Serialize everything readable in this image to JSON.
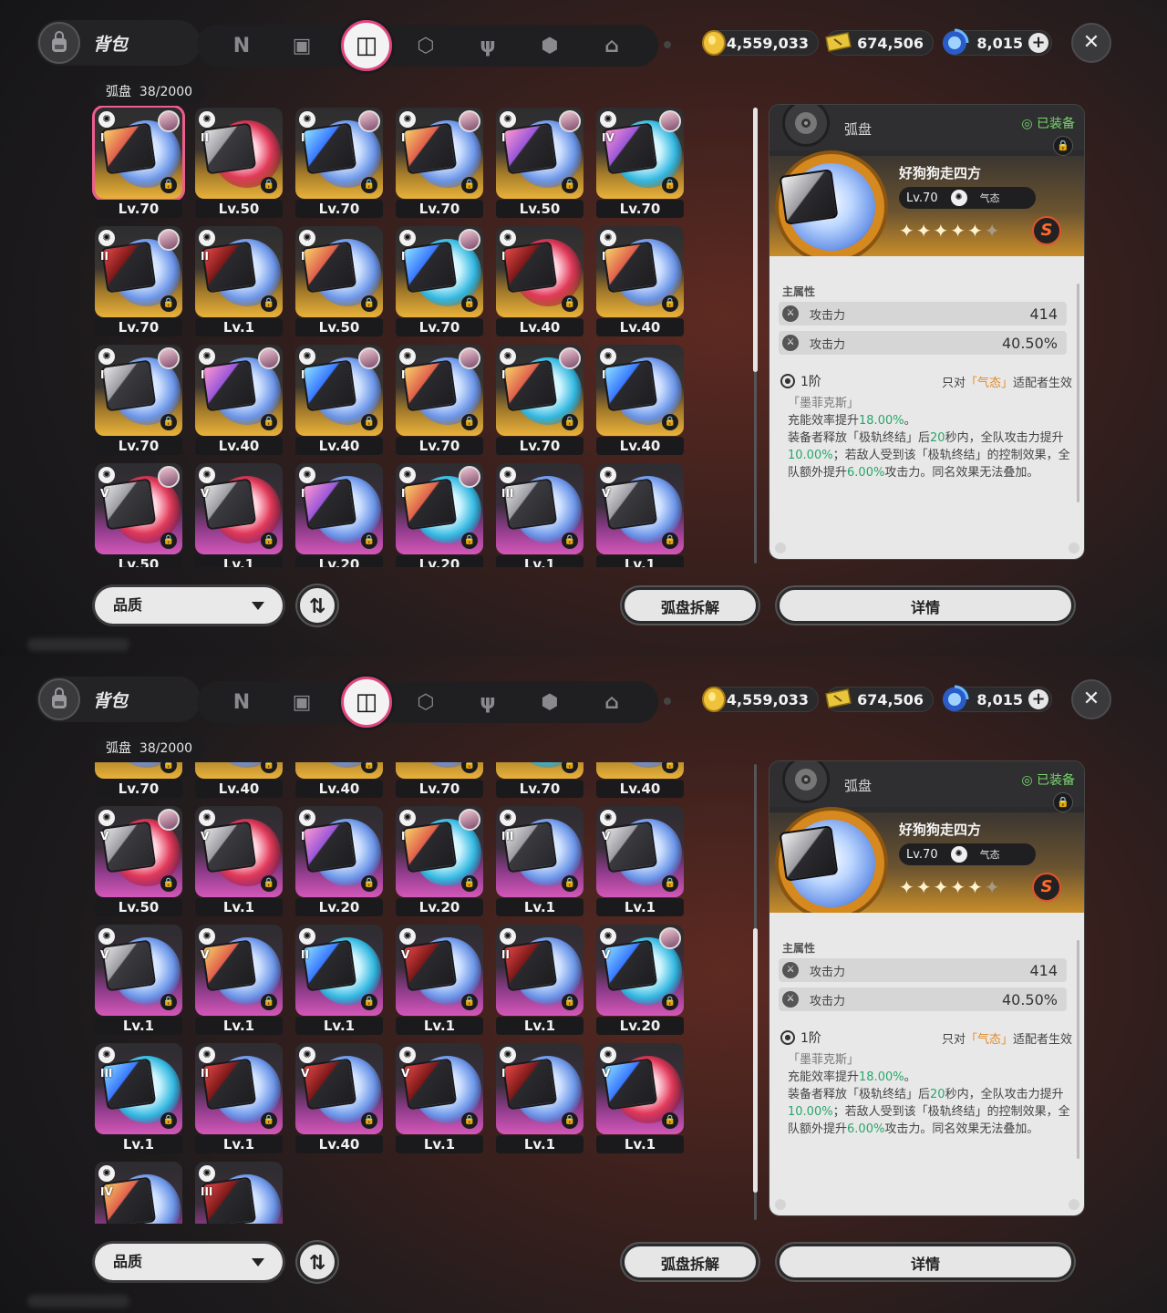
{
  "bag": {
    "title": "背包",
    "icon": "backpack-icon"
  },
  "tabs": [
    {
      "name": "agent-tab-icon",
      "glyph": "N"
    },
    {
      "name": "device-tab-icon",
      "glyph": "▣"
    },
    {
      "name": "disc-tab-icon",
      "glyph": "◫",
      "active": true
    },
    {
      "name": "box-tab-icon",
      "glyph": "⬡"
    },
    {
      "name": "food-tab-icon",
      "glyph": "ψ"
    },
    {
      "name": "shield-tab-icon",
      "glyph": "⬢"
    },
    {
      "name": "home-tab-icon",
      "glyph": "⌂"
    }
  ],
  "currency": {
    "coins": "4,559,033",
    "tickets": "674,506",
    "gems": "8,015"
  },
  "inventory": {
    "label": "弧盘",
    "count": "38/2000"
  },
  "top_cards": [
    {
      "lv": "Lv.70",
      "rank": "I",
      "rarity": "gold",
      "avatar": true,
      "selected": true,
      "disc": "blue",
      "art": "art1"
    },
    {
      "lv": "Lv.50",
      "rank": "II",
      "rarity": "gold",
      "avatar": false,
      "disc": "red",
      "art": ""
    },
    {
      "lv": "Lv.70",
      "rank": "I",
      "rarity": "gold",
      "avatar": true,
      "disc": "blue",
      "art": "art3"
    },
    {
      "lv": "Lv.70",
      "rank": "I",
      "rarity": "gold",
      "avatar": true,
      "disc": "blue",
      "art": "art1"
    },
    {
      "lv": "Lv.50",
      "rank": "I",
      "rarity": "gold",
      "avatar": true,
      "disc": "blue",
      "art": "art2"
    },
    {
      "lv": "Lv.70",
      "rank": "IV",
      "rarity": "gold",
      "avatar": true,
      "disc": "cyan",
      "art": "art2"
    },
    {
      "lv": "Lv.70",
      "rank": "II",
      "rarity": "gold",
      "avatar": true,
      "disc": "blue",
      "art": "art4"
    },
    {
      "lv": "Lv.1",
      "rank": "II",
      "rarity": "gold",
      "avatar": false,
      "disc": "blue",
      "art": "art4"
    },
    {
      "lv": "Lv.50",
      "rank": "I",
      "rarity": "gold",
      "avatar": false,
      "disc": "blue",
      "art": "art1"
    },
    {
      "lv": "Lv.70",
      "rank": "I",
      "rarity": "gold",
      "avatar": true,
      "disc": "cyan",
      "art": "art3"
    },
    {
      "lv": "Lv.40",
      "rank": "I",
      "rarity": "gold",
      "avatar": false,
      "disc": "red",
      "art": "art4"
    },
    {
      "lv": "Lv.40",
      "rank": "I",
      "rarity": "gold",
      "avatar": false,
      "disc": "blue",
      "art": "art1"
    },
    {
      "lv": "Lv.70",
      "rank": "I",
      "rarity": "gold",
      "avatar": true,
      "disc": "blue",
      "art": ""
    },
    {
      "lv": "Lv.40",
      "rank": "I",
      "rarity": "gold",
      "avatar": true,
      "disc": "blue",
      "art": "art2"
    },
    {
      "lv": "Lv.40",
      "rank": "I",
      "rarity": "gold",
      "avatar": true,
      "disc": "blue",
      "art": "art3"
    },
    {
      "lv": "Lv.70",
      "rank": "I",
      "rarity": "gold",
      "avatar": true,
      "disc": "blue",
      "art": "art1"
    },
    {
      "lv": "Lv.70",
      "rank": "I",
      "rarity": "gold",
      "avatar": true,
      "disc": "cyan",
      "art": "art1"
    },
    {
      "lv": "Lv.40",
      "rank": "I",
      "rarity": "gold",
      "avatar": false,
      "disc": "blue",
      "art": "art3"
    },
    {
      "lv": "Lv.50",
      "rank": "V",
      "rarity": "purple",
      "avatar": true,
      "disc": "red",
      "art": ""
    },
    {
      "lv": "Lv.1",
      "rank": "V",
      "rarity": "purple",
      "avatar": false,
      "disc": "red",
      "art": ""
    },
    {
      "lv": "Lv.20",
      "rank": "I",
      "rarity": "purple",
      "avatar": false,
      "disc": "blue",
      "art": "art2"
    },
    {
      "lv": "Lv.20",
      "rank": "I",
      "rarity": "purple",
      "avatar": true,
      "disc": "cyan",
      "art": "art1"
    },
    {
      "lv": "Lv.1",
      "rank": "III",
      "rarity": "purple",
      "avatar": false,
      "disc": "blue",
      "art": ""
    },
    {
      "lv": "Lv.1",
      "rank": "V",
      "rarity": "purple",
      "avatar": false,
      "disc": "blue",
      "art": ""
    }
  ],
  "bottom_cards": [
    {
      "lv": "Lv.70",
      "rank": "",
      "rarity": "gold",
      "avatar": false,
      "disc": "blue",
      "art": ""
    },
    {
      "lv": "Lv.40",
      "rank": "",
      "rarity": "gold",
      "avatar": false,
      "disc": "blue",
      "art": ""
    },
    {
      "lv": "Lv.40",
      "rank": "",
      "rarity": "gold",
      "avatar": false,
      "disc": "blue",
      "art": ""
    },
    {
      "lv": "Lv.70",
      "rank": "",
      "rarity": "gold",
      "avatar": false,
      "disc": "blue",
      "art": ""
    },
    {
      "lv": "Lv.70",
      "rank": "",
      "rarity": "gold",
      "avatar": false,
      "disc": "cyan",
      "art": ""
    },
    {
      "lv": "Lv.40",
      "rank": "",
      "rarity": "gold",
      "avatar": false,
      "disc": "blue",
      "art": ""
    },
    {
      "lv": "Lv.50",
      "rank": "V",
      "rarity": "purple",
      "avatar": true,
      "disc": "red",
      "art": ""
    },
    {
      "lv": "Lv.1",
      "rank": "V",
      "rarity": "purple",
      "avatar": false,
      "disc": "red",
      "art": ""
    },
    {
      "lv": "Lv.20",
      "rank": "I",
      "rarity": "purple",
      "avatar": false,
      "disc": "blue",
      "art": "art2"
    },
    {
      "lv": "Lv.20",
      "rank": "I",
      "rarity": "purple",
      "avatar": true,
      "disc": "cyan",
      "art": "art1"
    },
    {
      "lv": "Lv.1",
      "rank": "III",
      "rarity": "purple",
      "avatar": false,
      "disc": "blue",
      "art": ""
    },
    {
      "lv": "Lv.1",
      "rank": "V",
      "rarity": "purple",
      "avatar": false,
      "disc": "blue",
      "art": ""
    },
    {
      "lv": "Lv.1",
      "rank": "V",
      "rarity": "purple",
      "avatar": false,
      "disc": "blue",
      "art": ""
    },
    {
      "lv": "Lv.1",
      "rank": "V",
      "rarity": "purple",
      "avatar": false,
      "disc": "blue",
      "art": "art1"
    },
    {
      "lv": "Lv.1",
      "rank": "II",
      "rarity": "purple",
      "avatar": false,
      "disc": "cyan",
      "art": "art3"
    },
    {
      "lv": "Lv.1",
      "rank": "V",
      "rarity": "purple",
      "avatar": false,
      "disc": "blue",
      "art": "art4"
    },
    {
      "lv": "Lv.1",
      "rank": "II",
      "rarity": "purple",
      "avatar": false,
      "disc": "blue",
      "art": "art4"
    },
    {
      "lv": "Lv.20",
      "rank": "V",
      "rarity": "purple",
      "avatar": true,
      "disc": "cyan",
      "art": "art3"
    },
    {
      "lv": "Lv.1",
      "rank": "III",
      "rarity": "purple",
      "avatar": false,
      "disc": "cyan",
      "art": "art3"
    },
    {
      "lv": "Lv.1",
      "rank": "II",
      "rarity": "purple",
      "avatar": false,
      "disc": "blue",
      "art": "art4"
    },
    {
      "lv": "Lv.40",
      "rank": "V",
      "rarity": "purple",
      "avatar": false,
      "disc": "blue",
      "art": "art4"
    },
    {
      "lv": "Lv.1",
      "rank": "V",
      "rarity": "purple",
      "avatar": false,
      "disc": "blue",
      "art": "art4"
    },
    {
      "lv": "Lv.1",
      "rank": "I",
      "rarity": "purple",
      "avatar": false,
      "disc": "blue",
      "art": "art4"
    },
    {
      "lv": "Lv.1",
      "rank": "V",
      "rarity": "purple",
      "avatar": false,
      "disc": "red",
      "art": "art3"
    },
    {
      "lv": "",
      "rank": "IV",
      "rarity": "purple",
      "avatar": false,
      "disc": "blue",
      "art": "art1"
    },
    {
      "lv": "",
      "rank": "III",
      "rarity": "purple",
      "avatar": false,
      "disc": "blue",
      "art": "art4"
    }
  ],
  "detail": {
    "category": "弧盘",
    "equipped": "◎ 已装备",
    "name": "好狗狗走四方",
    "level": "Lv.70",
    "attribute": "气态",
    "stars": "✦✦✦✦✦",
    "dim_star": "✦",
    "grade": "S",
    "main_label": "主属性",
    "stats": [
      {
        "label": "攻击力",
        "value": "414"
      },
      {
        "label": "攻击力",
        "value": "40.50%"
      }
    ],
    "tier": "1阶",
    "cond_pre": "只对",
    "cond_attr": "「气态」",
    "cond_post": "适配者生效",
    "desc_quote": "「墨菲克斯」",
    "desc_1a": "充能效率提升",
    "desc_1b": "18.00%",
    "desc_1c": "。",
    "desc_2a": "装备者释放「极轨终结」后",
    "desc_2b": "20",
    "desc_2c": "秒内，全队攻击力提升",
    "desc_2d": "10.00%",
    "desc_2e": "；若敌人受到该「极轨终结」的控制效果，全队额外提升",
    "desc_2f": "6.00%",
    "desc_2g": "攻击力。同名效果无法叠加。"
  },
  "buttons": {
    "quality": "品质",
    "dismantle": "弧盘拆解",
    "details": "详情",
    "sort_glyph": "⇅"
  },
  "colors": {
    "accent": "#e0457e",
    "gold": "#e9b23a",
    "purple": "#d457b9",
    "green_text": "#2aa66c",
    "orange_text": "#e38a25"
  }
}
